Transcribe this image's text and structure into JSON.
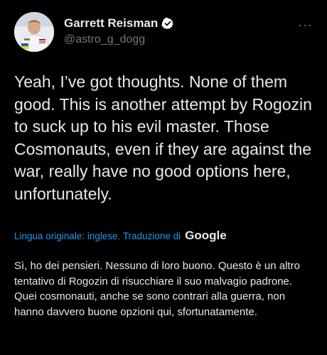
{
  "author": {
    "name": "Garrett Reisman",
    "handle": "@astro_g_dogg",
    "verified": true,
    "avatar_icon": "astronaut-avatar-icon"
  },
  "menu": {
    "more_label": "···"
  },
  "tweet": {
    "text": "Yeah, I’ve got thoughts. None of them good. This is another attempt by Rogozin to suck up to his evil master. Those Cosmonauts, even if they are against the war, really have no good options here, unfortunately."
  },
  "translation": {
    "notice": "Lingua originale: inglese. Traduzione di",
    "provider": "Google",
    "text": "Sì, ho dei pensieri. Nessuno di loro buono. Questo è un altro tentativo di Rogozin di risucchiare il suo malvagio padrone. Quei cosmonauti, anche se sono contrari alla guerra, non hanno davvero buone opzioni qui, sfortunatamente."
  },
  "colors": {
    "background": "#000000",
    "text": "#e7e9ea",
    "secondary": "#71767b",
    "link": "#1d9bf0",
    "verified_badge": "#ffffff"
  }
}
